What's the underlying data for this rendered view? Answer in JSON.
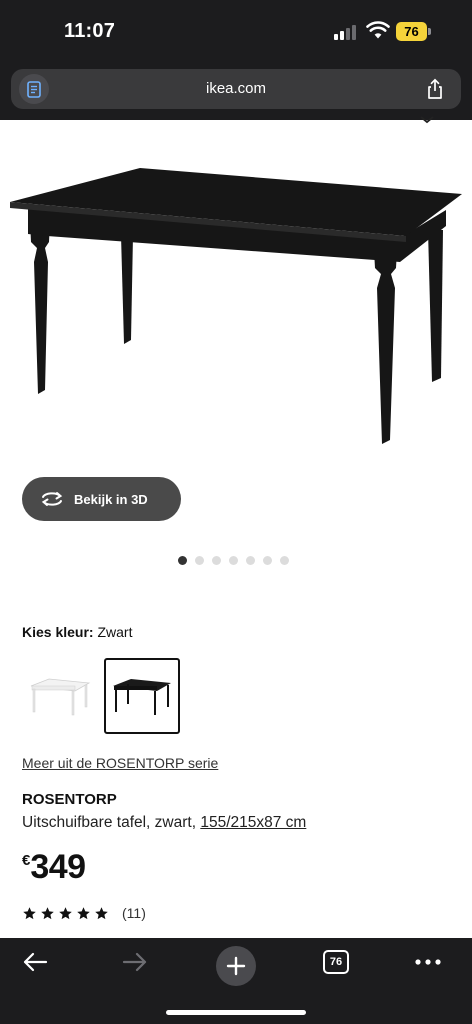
{
  "status": {
    "time": "11:07",
    "battery": "76"
  },
  "browser": {
    "url": "ikea.com",
    "tab_count": "76"
  },
  "product": {
    "view_3d_label": "Bekijk in 3D",
    "gallery": {
      "total_images": 7,
      "active_index": 0
    },
    "color_label": "Kies kleur:",
    "color_value": "Zwart",
    "swatches": [
      {
        "name": "Wit",
        "selected": false
      },
      {
        "name": "Zwart",
        "selected": true
      }
    ],
    "series_link": "Meer uit de ROSENTORP serie",
    "name": "ROSENTORP",
    "description": "Uitschuifbare tafel, zwart,",
    "dimensions": "155/215x87 cm",
    "currency": "€",
    "price": "349",
    "rating": {
      "stars": 5,
      "reviews": "(11)"
    }
  },
  "colors": {
    "chrome": "#1c1c1e",
    "url_bar": "#3a3a3c",
    "battery": "#f5d33a",
    "button_3d": "#4a4a4a"
  }
}
